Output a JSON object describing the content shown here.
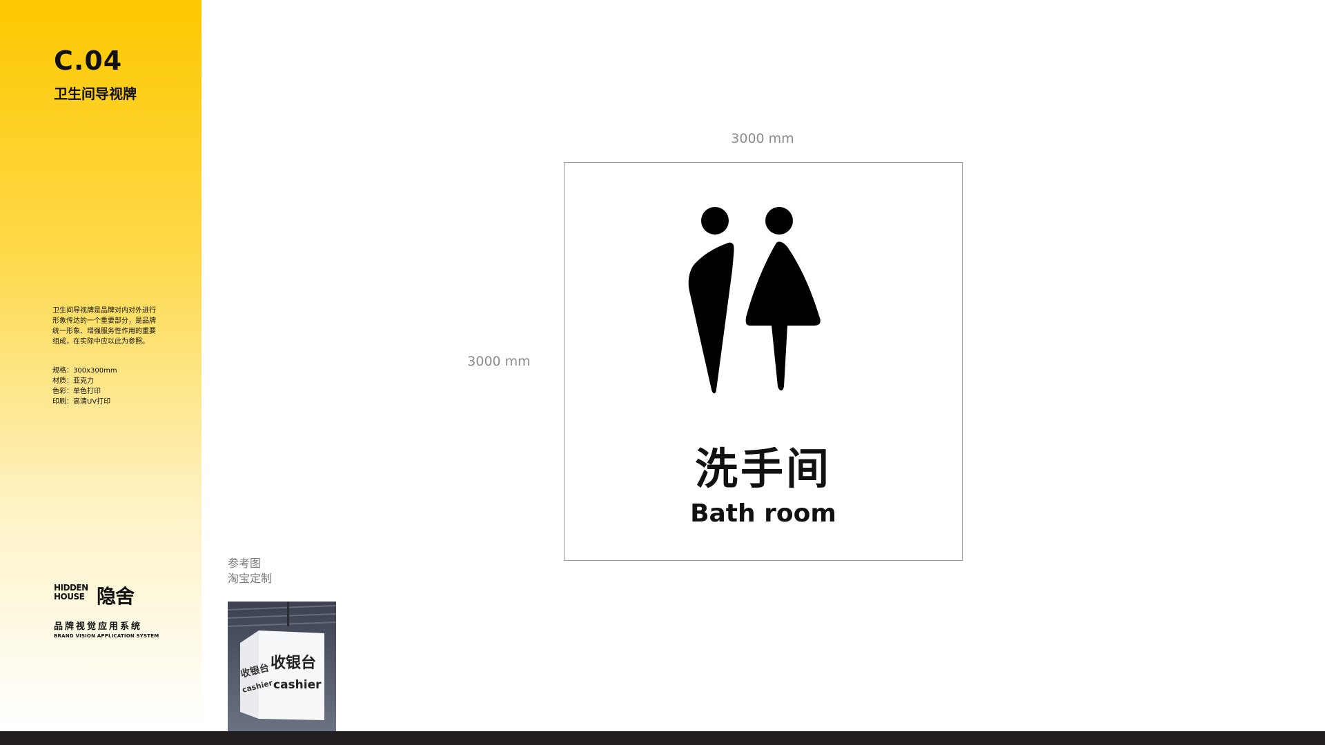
{
  "sidebar": {
    "code": "C.04",
    "title": "卫生间导视牌",
    "description": "卫生间导视牌是品牌对内对外进行形象传达的一个重要部分，是品牌统一形象、增强服务性作用的重要组成，在实际中应以此为参照。",
    "specs": [
      "规格：300x300mm",
      "材质：亚克力",
      "色彩：单色打印",
      "印刷：高清UV打印"
    ],
    "logo": {
      "en_line1": "HIDDEN",
      "en_line2": "HOUSE",
      "cn": "隐舍"
    },
    "brand_cn": "品牌视觉应用系统",
    "brand_en": "BRAND VISION APPLICATION SYSTEM",
    "accent_color": "#fdc800"
  },
  "main": {
    "dimension_top": "3000 mm",
    "dimension_left": "3000 mm",
    "sign": {
      "icon": "male-female-restroom-icon",
      "title_cn": "洗手间",
      "title_en": "Bath room"
    },
    "reference": {
      "label_line1": "参考图",
      "label_line2": "淘宝定制",
      "photo_front_cn": "收银台",
      "photo_front_en": "cashier",
      "photo_side_cn": "收银台",
      "photo_side_en": "cashier"
    }
  },
  "footer_bar_color": "#231f20"
}
